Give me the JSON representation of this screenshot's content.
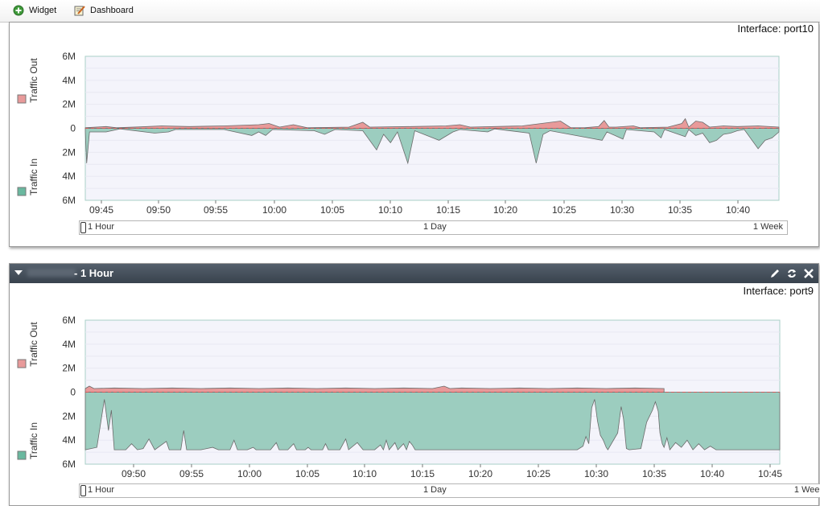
{
  "toolbar": {
    "widget_label": "Widget",
    "dashboard_label": "Dashboard"
  },
  "widget1": {
    "interface": "Interface: port10",
    "range": {
      "left": "1 Hour",
      "mid": "1 Day",
      "right": "1 Week"
    }
  },
  "widget2": {
    "title": "- 1 Hour",
    "interface": "Interface: port9",
    "range": {
      "left": "1 Hour",
      "mid": "1 Day",
      "right": "1 Week"
    }
  },
  "colors": {
    "out": "#e89a9a",
    "in": "#9ccdbf",
    "line": "#556b66"
  },
  "chart_data": [
    {
      "type": "area",
      "ylabels": [
        "6M",
        "4M",
        "2M",
        "0",
        "2M",
        "4M",
        "6M"
      ],
      "legend": [
        {
          "name": "Traffic Out",
          "color": "#e89a9a"
        },
        {
          "name": "Traffic In",
          "color": "#6ab89f"
        }
      ],
      "x_start": "09:43.3",
      "x_end": "10:43.3",
      "xticks": [
        "09:45",
        "09:50",
        "09:55",
        "10:00",
        "10:05",
        "10:10",
        "10:15",
        "10:20",
        "10:25",
        "10:30",
        "10:35",
        "10:40"
      ],
      "traffic_out_M": [
        [
          0,
          0.05
        ],
        [
          3,
          0.15
        ],
        [
          4.5,
          0.05
        ],
        [
          8,
          0.12
        ],
        [
          11,
          0.2
        ],
        [
          15,
          0.15
        ],
        [
          20,
          0.2
        ],
        [
          25,
          0.3
        ],
        [
          26.5,
          0.4
        ],
        [
          28,
          0.1
        ],
        [
          30,
          0.3
        ],
        [
          32,
          0.05
        ],
        [
          38,
          0.1
        ],
        [
          40,
          0.5
        ],
        [
          41,
          0.1
        ],
        [
          47,
          0.15
        ],
        [
          52,
          0.2
        ],
        [
          54,
          0.3
        ],
        [
          55.5,
          0.1
        ],
        [
          63,
          0.2
        ],
        [
          68.5,
          0.6
        ],
        [
          70,
          0.05
        ],
        [
          72,
          0.05
        ],
        [
          74,
          0.15
        ],
        [
          74.8,
          0.65
        ],
        [
          75.5,
          0.1
        ],
        [
          76.5,
          0.1
        ],
        [
          79,
          0.2
        ],
        [
          80,
          0.05
        ],
        [
          84,
          0.1
        ],
        [
          86,
          0.4
        ],
        [
          86.5,
          0.8
        ],
        [
          87,
          0.1
        ],
        [
          88,
          0.6
        ],
        [
          89,
          0.5
        ],
        [
          90,
          0.1
        ],
        [
          92,
          0.2
        ],
        [
          94,
          0.15
        ],
        [
          97,
          0.2
        ],
        [
          100,
          0.1
        ]
      ],
      "traffic_in_M": [
        [
          0,
          0.3
        ],
        [
          0.2,
          2.9
        ],
        [
          0.6,
          0.3
        ],
        [
          3,
          0.3
        ],
        [
          5,
          0.05
        ],
        [
          10,
          0.4
        ],
        [
          12,
          0.3
        ],
        [
          13,
          0.1
        ],
        [
          20,
          0.1
        ],
        [
          24,
          0.6
        ],
        [
          25,
          0.3
        ],
        [
          26,
          0.6
        ],
        [
          27,
          0.1
        ],
        [
          33,
          0.2
        ],
        [
          34.5,
          0.5
        ],
        [
          36,
          0.1
        ],
        [
          40,
          0.2
        ],
        [
          42,
          1.8
        ],
        [
          43,
          0.5
        ],
        [
          44,
          1.2
        ],
        [
          45,
          0.3
        ],
        [
          46.5,
          2.9
        ],
        [
          47.5,
          0.2
        ],
        [
          51,
          1.0
        ],
        [
          53,
          0.3
        ],
        [
          54,
          0.1
        ],
        [
          58,
          0.3
        ],
        [
          59,
          0.05
        ],
        [
          64,
          0.4
        ],
        [
          65,
          2.9
        ],
        [
          66,
          0.5
        ],
        [
          67,
          0.2
        ],
        [
          74.5,
          1.0
        ],
        [
          75.2,
          0.3
        ],
        [
          77.5,
          0.9
        ],
        [
          78,
          0.1
        ],
        [
          82,
          0.3
        ],
        [
          83,
          0.8
        ],
        [
          83.5,
          0.1
        ],
        [
          86.5,
          0.7
        ],
        [
          87,
          0.1
        ],
        [
          88,
          0.6
        ],
        [
          89,
          0.4
        ],
        [
          90,
          1.2
        ],
        [
          91,
          1.0
        ],
        [
          92,
          0.5
        ],
        [
          93,
          0.4
        ],
        [
          94,
          0.2
        ],
        [
          95,
          0.1
        ],
        [
          97,
          1.7
        ],
        [
          98,
          1.0
        ],
        [
          99,
          0.8
        ],
        [
          100,
          0.3
        ]
      ]
    },
    {
      "type": "area",
      "ylabels": [
        "6M",
        "4M",
        "2M",
        "0",
        "2M",
        "4M",
        "6M"
      ],
      "legend": [
        {
          "name": "Traffic Out",
          "color": "#e89a9a"
        },
        {
          "name": "Traffic In",
          "color": "#6ab89f"
        }
      ],
      "x_start": "09:46.2",
      "x_end": "10:46.2",
      "xticks": [
        "09:50",
        "09:55",
        "10:00",
        "10:05",
        "10:10",
        "10:15",
        "10:20",
        "10:25",
        "10:30",
        "10:35",
        "10:40",
        "10:45"
      ],
      "traffic_out_M": [
        [
          0,
          0.3
        ],
        [
          0.7,
          0.5
        ],
        [
          1.5,
          0.3
        ],
        [
          5,
          0.35
        ],
        [
          10,
          0.3
        ],
        [
          15,
          0.35
        ],
        [
          20,
          0.3
        ],
        [
          25,
          0.35
        ],
        [
          30,
          0.3
        ],
        [
          35,
          0.35
        ],
        [
          40,
          0.3
        ],
        [
          45,
          0.35
        ],
        [
          50,
          0.3
        ],
        [
          55,
          0.35
        ],
        [
          60,
          0.3
        ],
        [
          62,
          0.5
        ],
        [
          63,
          0.3
        ],
        [
          65,
          0.35
        ],
        [
          70,
          0.3
        ],
        [
          75,
          0.35
        ],
        [
          80,
          0.3
        ],
        [
          85,
          0.35
        ],
        [
          90,
          0.3
        ],
        [
          95,
          0.35
        ],
        [
          100,
          0.3
        ]
      ],
      "traffic_in_M": [
        [
          0,
          4.8
        ],
        [
          2,
          4.6
        ],
        [
          3.3,
          0.6
        ],
        [
          4,
          3.2
        ],
        [
          4.5,
          1.5
        ],
        [
          5,
          4.8
        ],
        [
          7,
          4.8
        ],
        [
          8,
          4.3
        ],
        [
          9,
          4.8
        ],
        [
          10,
          4.7
        ],
        [
          11,
          3.9
        ],
        [
          12,
          4.8
        ],
        [
          14,
          4.1
        ],
        [
          14.5,
          4.8
        ],
        [
          16.5,
          4.8
        ],
        [
          17,
          3.2
        ],
        [
          17.5,
          4.8
        ],
        [
          20,
          4.8
        ],
        [
          22,
          4.6
        ],
        [
          23,
          4.8
        ],
        [
          25,
          4.8
        ],
        [
          25.7,
          4.0
        ],
        [
          26.3,
          4.8
        ],
        [
          28,
          4.8
        ],
        [
          29,
          4.6
        ],
        [
          29.5,
          4.8
        ],
        [
          32,
          4.8
        ],
        [
          33,
          4.2
        ],
        [
          33.5,
          4.8
        ],
        [
          35,
          4.8
        ],
        [
          36,
          4.3
        ],
        [
          36.5,
          4.8
        ],
        [
          38,
          4.8
        ],
        [
          38.5,
          4.6
        ],
        [
          39,
          4.8
        ],
        [
          41,
          4.8
        ],
        [
          41.5,
          4.3
        ],
        [
          42,
          4.8
        ],
        [
          44,
          4.8
        ],
        [
          45,
          3.9
        ],
        [
          45.5,
          4.8
        ],
        [
          47,
          4.2
        ],
        [
          48,
          4.8
        ],
        [
          50,
          4.8
        ],
        [
          51,
          4.4
        ],
        [
          51.5,
          4.8
        ],
        [
          52,
          4.0
        ],
        [
          52.5,
          4.8
        ],
        [
          53.5,
          4.2
        ],
        [
          54,
          4.8
        ],
        [
          55,
          4.3
        ],
        [
          55.5,
          4.8
        ],
        [
          56,
          4.1
        ],
        [
          56.5,
          4.4
        ],
        [
          57,
          4.8
        ],
        [
          60,
          4.8
        ],
        [
          65,
          4.8
        ],
        [
          70,
          4.8
        ],
        [
          75,
          4.8
        ],
        [
          80,
          4.8
        ],
        [
          85,
          4.8
        ],
        [
          86,
          4.5
        ],
        [
          86.5,
          3.7
        ],
        [
          87,
          4.3
        ],
        [
          87.5,
          1.3
        ],
        [
          88,
          0.6
        ],
        [
          88.5,
          2.4
        ],
        [
          89,
          3.6
        ],
        [
          89.5,
          4.0
        ],
        [
          90,
          4.6
        ],
        [
          90.3,
          4.8
        ],
        [
          92,
          3.4
        ],
        [
          92.6,
          1.2
        ],
        [
          93,
          2.2
        ],
        [
          93.5,
          4.7
        ],
        [
          94,
          4.8
        ],
        [
          96,
          4.7
        ],
        [
          97,
          2.5
        ],
        [
          98,
          1.5
        ],
        [
          98.5,
          0.8
        ],
        [
          99,
          1.6
        ],
        [
          99.3,
          3.4
        ],
        [
          99.7,
          4.3
        ],
        [
          100,
          4.6
        ],
        [
          100.5,
          3.8
        ],
        [
          101,
          4.8
        ],
        [
          102,
          4.2
        ],
        [
          103,
          4.6
        ],
        [
          104,
          4.0
        ],
        [
          105,
          4.8
        ],
        [
          106,
          4.3
        ],
        [
          107,
          4.8
        ],
        [
          108,
          4.5
        ],
        [
          109,
          4.8
        ],
        [
          112,
          4.8
        ],
        [
          115,
          4.8
        ],
        [
          120,
          4.8
        ]
      ]
    }
  ]
}
